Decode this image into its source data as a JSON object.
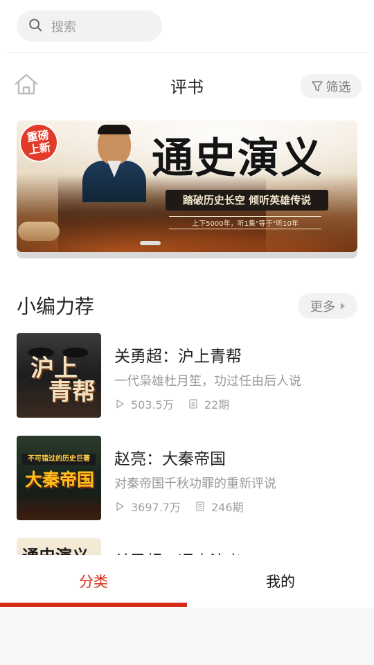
{
  "search": {
    "placeholder": "搜索",
    "icon": "search-icon"
  },
  "header": {
    "title": "评书",
    "filter_label": "筛选",
    "home_icon": "home-icon",
    "filter_icon": "filter-icon"
  },
  "banner": {
    "badge_line1": "重磅",
    "badge_line2": "上新",
    "title": "通史演义",
    "tagline": "踏破历史长空  倾听英雄传说",
    "subline": "上下5000年，听1集\"等于\"听10年"
  },
  "recommend": {
    "title": "小编力荐",
    "more_label": "更多",
    "items": [
      {
        "title": "关勇超：沪上青帮",
        "desc": "一代枭雄杜月笙，功过任由后人说",
        "plays": "503.5万",
        "episodes": "22期",
        "cover_line1": "沪上",
        "cover_line2": "青帮"
      },
      {
        "title": "赵亮：大秦帝国",
        "desc": "对秦帝国千秋功罪的重新评说",
        "plays": "3697.7万",
        "episodes": "246期",
        "cover_strip": "不可错过的历史巨著",
        "cover_title": "大秦帝国"
      },
      {
        "title": "关勇超：通史演义",
        "cover_title": "通史演义"
      }
    ]
  },
  "bottom_nav": {
    "tabs": [
      {
        "label": "分类",
        "active": true
      },
      {
        "label": "我的",
        "active": false
      }
    ],
    "active_color": "#d62a14"
  }
}
